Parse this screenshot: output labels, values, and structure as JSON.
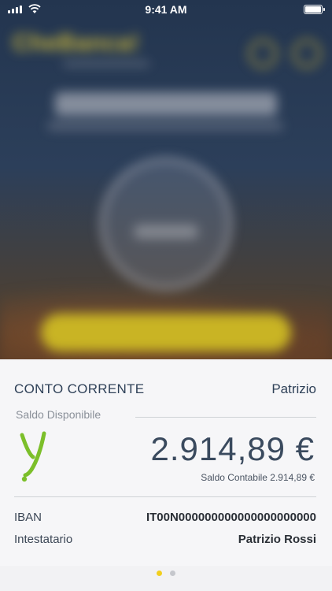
{
  "statusbar": {
    "time": "9:41 AM"
  },
  "background": {
    "brand_text": "CheBanca!"
  },
  "account": {
    "title": "CONTO CORRENTE",
    "owner_short": "Patrizio",
    "saldo_label": "Saldo Disponibile",
    "balance": "2.914,89 €",
    "saldo_contabile": "Saldo Contabile 2.914,89 €",
    "iban_label": "IBAN",
    "iban_value": "IT00N000000000000000000000",
    "holder_label": "Intestatario",
    "holder_value": "Patrizio Rossi",
    "logo_icon": "y-logo-icon",
    "logo_color": "#7cbf2a"
  },
  "pagination": {
    "active_color": "#f2cf1e",
    "inactive_color": "#c5c7cc",
    "pages": 2,
    "current": 1
  }
}
